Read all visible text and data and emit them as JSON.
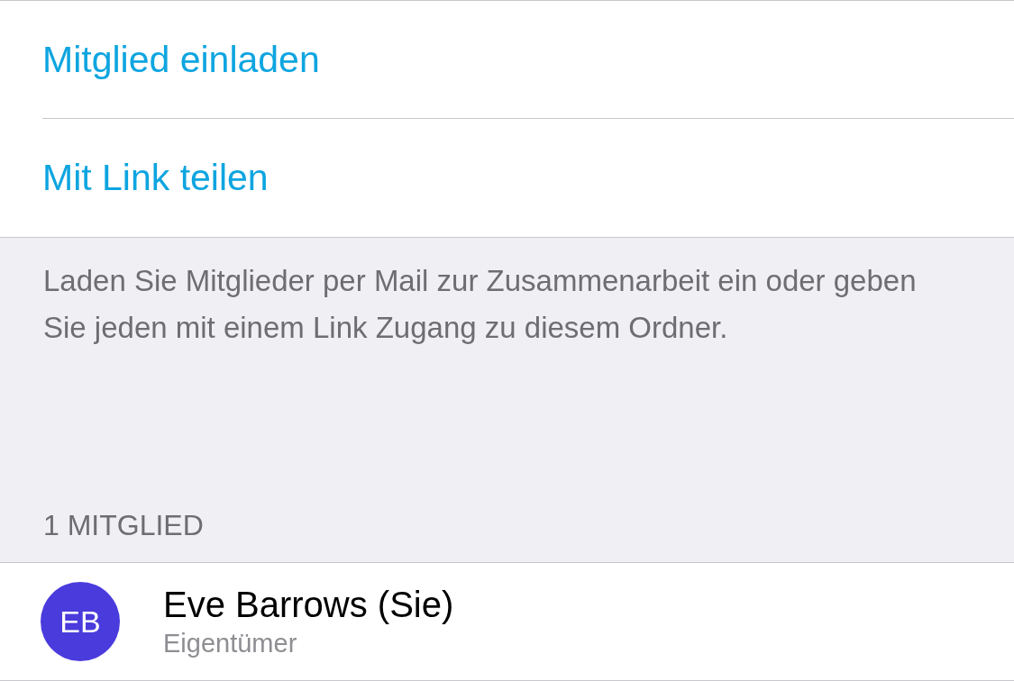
{
  "actions": [
    {
      "label": "Mitglied einladen"
    },
    {
      "label": "Mit Link teilen"
    }
  ],
  "footer": "Laden Sie Mitglieder per Mail zur Zusammenarbeit ein oder geben Sie jeden mit einem Link Zugang zu diesem Ordner.",
  "members_header": "1 MITGLIED",
  "members": [
    {
      "initials": "EB",
      "name": "Eve Barrows (Sie)",
      "role": "Eigentümer",
      "color": "#4a3bdc"
    }
  ]
}
